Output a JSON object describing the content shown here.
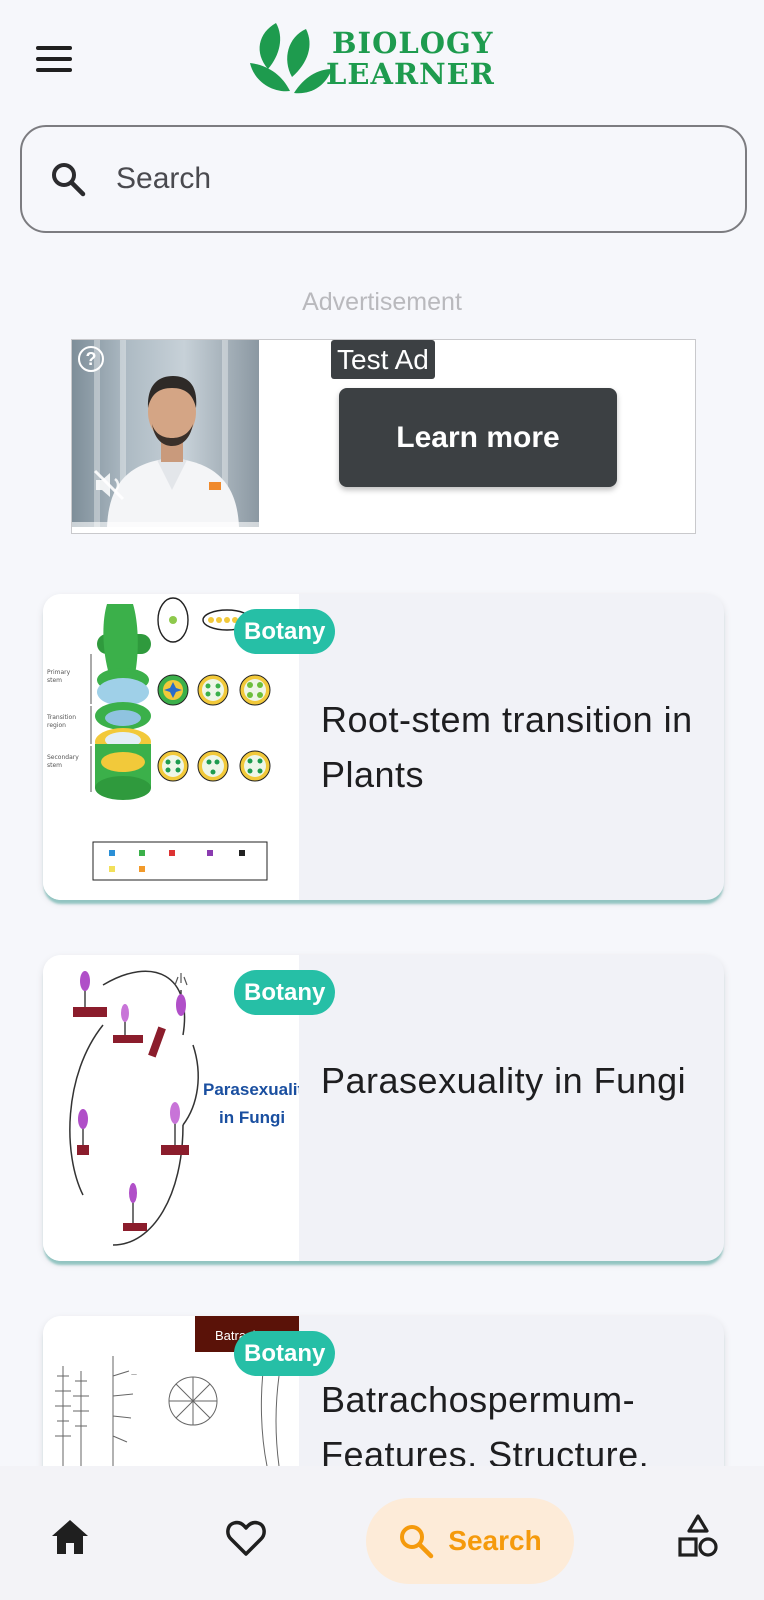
{
  "header": {
    "menu_icon": "hamburger-menu-icon",
    "logo_line1": "BIOLOGY",
    "logo_line2": "LEARNER",
    "brand_color": "#1e9b4e"
  },
  "search": {
    "placeholder": "Search",
    "icon": "search-icon"
  },
  "advertisement": {
    "label": "Advertisement",
    "tag": "Test Ad",
    "cta_label": "Learn more"
  },
  "articles": [
    {
      "category": "Botany",
      "title": "Root-stem transition in Plants"
    },
    {
      "category": "Botany",
      "title": "Parasexuality in Fungi",
      "thumb_text_line1": "Parasexuality",
      "thumb_text_line2": "in Fungi"
    },
    {
      "category": "Botany",
      "title": "Batrachospermum- Features, Structure,",
      "thumb_banner": "Batrachospermum"
    }
  ],
  "bottom_nav": {
    "items": [
      {
        "icon": "home-icon",
        "label": ""
      },
      {
        "icon": "heart-icon",
        "label": ""
      },
      {
        "icon": "search-icon",
        "label": "Search",
        "active": true
      },
      {
        "icon": "categories-icon",
        "label": ""
      }
    ],
    "active_color": "#f59a0c",
    "active_bg": "#fdebd8"
  },
  "colors": {
    "badge": "#26bfa6",
    "ad_button": "#3c4043"
  }
}
